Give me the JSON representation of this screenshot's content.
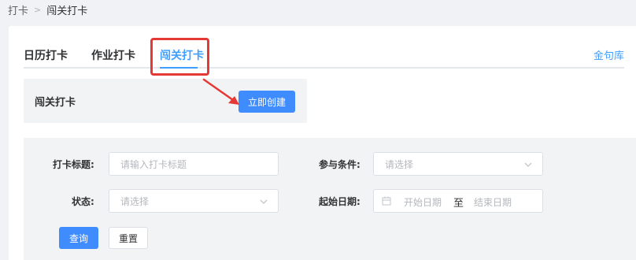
{
  "breadcrumb": {
    "root": "打卡",
    "separator": ">",
    "current": "闯关打卡"
  },
  "tabs": [
    {
      "label": "日历打卡"
    },
    {
      "label": "作业打卡"
    },
    {
      "label": "闯关打卡",
      "active": true
    }
  ],
  "header_link": "金句库",
  "create_section": {
    "title": "闯关打卡",
    "button_label": "立即创建"
  },
  "filters": {
    "title": {
      "label": "打卡标题:",
      "placeholder": "请输入打卡标题"
    },
    "condition": {
      "label": "参与条件:",
      "placeholder": "请选择"
    },
    "status": {
      "label": "状态:",
      "placeholder": "请选择"
    },
    "date": {
      "label": "起始日期:",
      "start_placeholder": "开始日期",
      "separator": "至",
      "end_placeholder": "结束日期"
    }
  },
  "actions": {
    "query_label": "查询",
    "reset_label": "重置"
  },
  "colors": {
    "accent": "#409eff",
    "highlight": "#e53935",
    "panel": "#f2f3f5"
  },
  "icons": {
    "chevron": "chevron-down-icon",
    "calendar": "calendar-icon",
    "separator": "chevron-right-icon"
  }
}
